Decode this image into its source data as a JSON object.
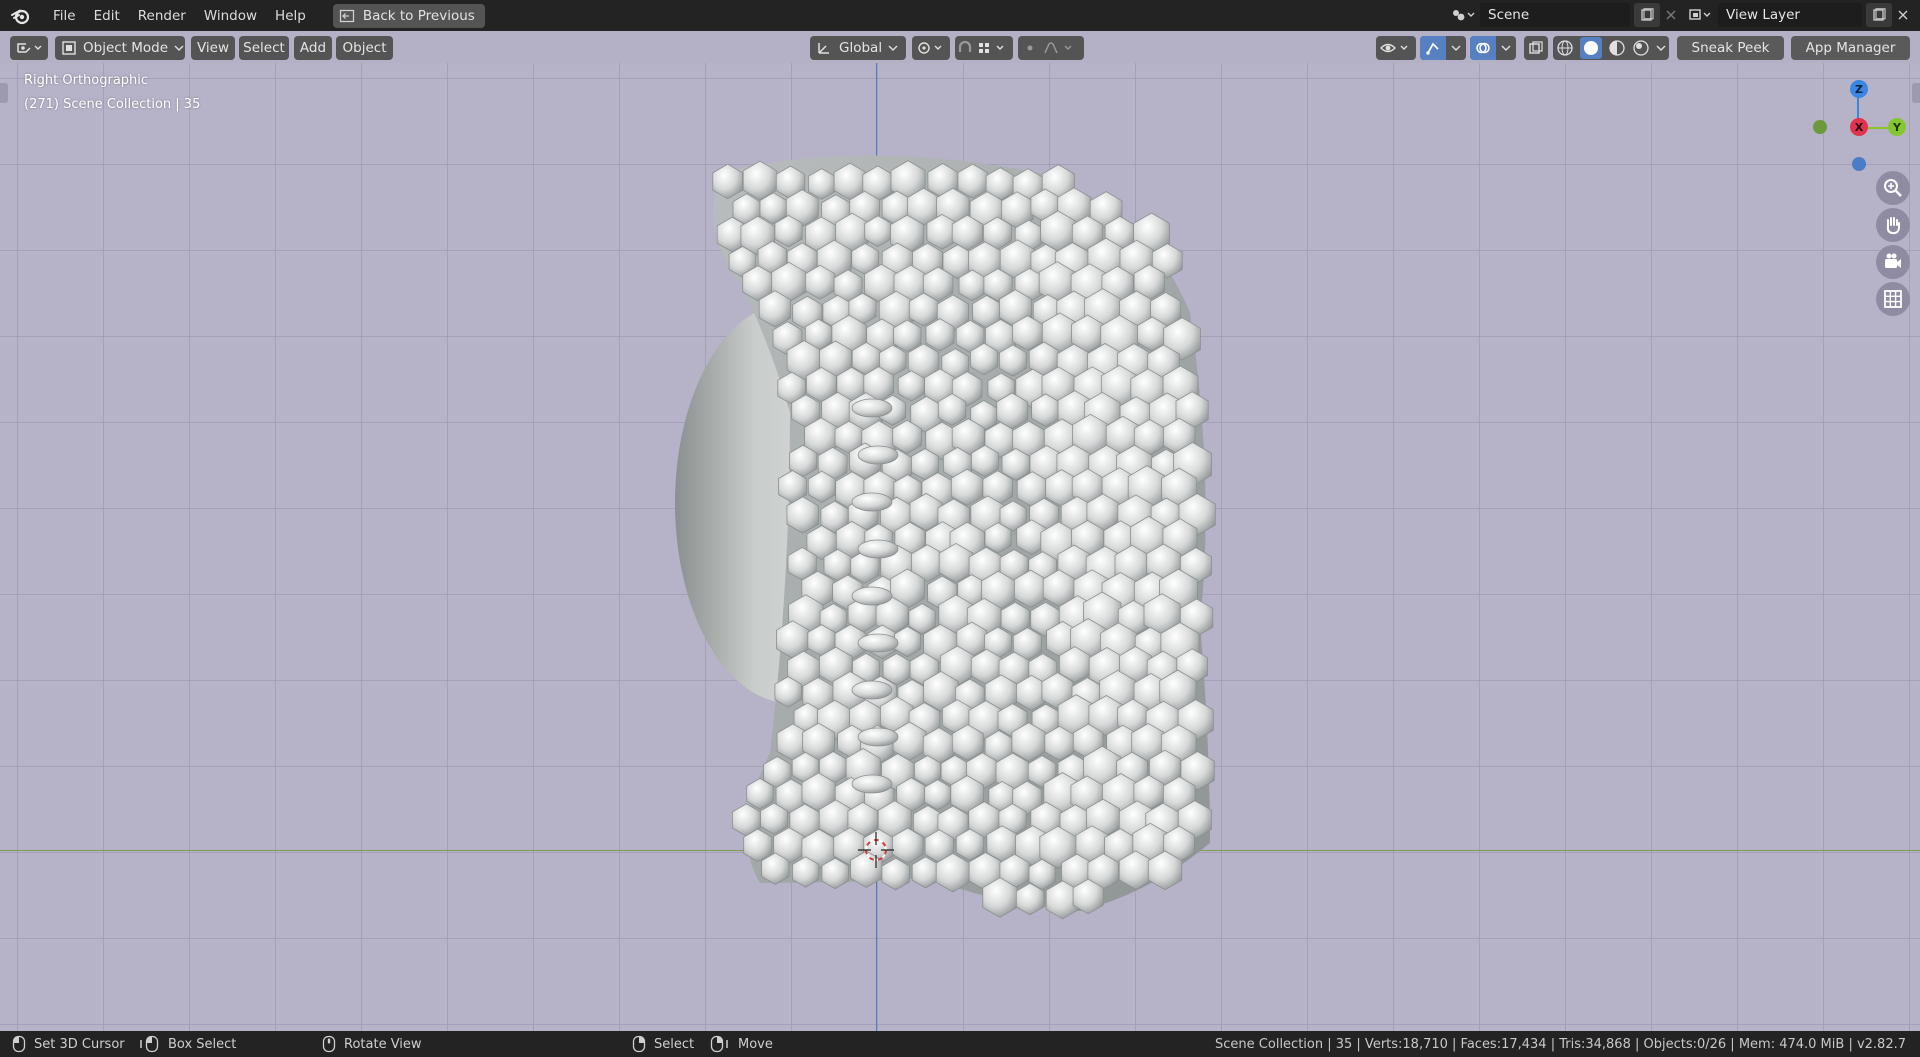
{
  "menubar": {
    "items": [
      "File",
      "Edit",
      "Render",
      "Window",
      "Help"
    ],
    "back_button": "Back to Previous",
    "scene_name": "Scene",
    "view_layer_name": "View Layer"
  },
  "viewport_header": {
    "mode": "Object Mode",
    "menus": [
      "View",
      "Select",
      "Add",
      "Object"
    ],
    "transform_orientation": "Global",
    "sneak_peek": "Sneak Peek",
    "app_manager": "App Manager"
  },
  "viewport": {
    "view_name": "Right Orthographic",
    "collection_info": "(271) Scene Collection | 35",
    "gizmo": {
      "z": "Z",
      "x": "X",
      "y": "Y"
    },
    "colors": {
      "background": "#b6b2c8",
      "axis_z": "#4b7ec9",
      "axis_y": "#7aa04a",
      "gizmo_x": "#e0344c",
      "gizmo_y": "#82c82c",
      "gizmo_z": "#3a86e0"
    }
  },
  "statusbar": {
    "set_cursor": "Set 3D Cursor",
    "box_select": "Box Select",
    "rotate_view": "Rotate View",
    "select": "Select",
    "move": "Move",
    "stats": "Scene Collection | 35 | Verts:18,710 | Faces:17,434 | Tris:34,868 | Objects:0/26 | Mem: 474.0 MiB | v2.82.7"
  }
}
